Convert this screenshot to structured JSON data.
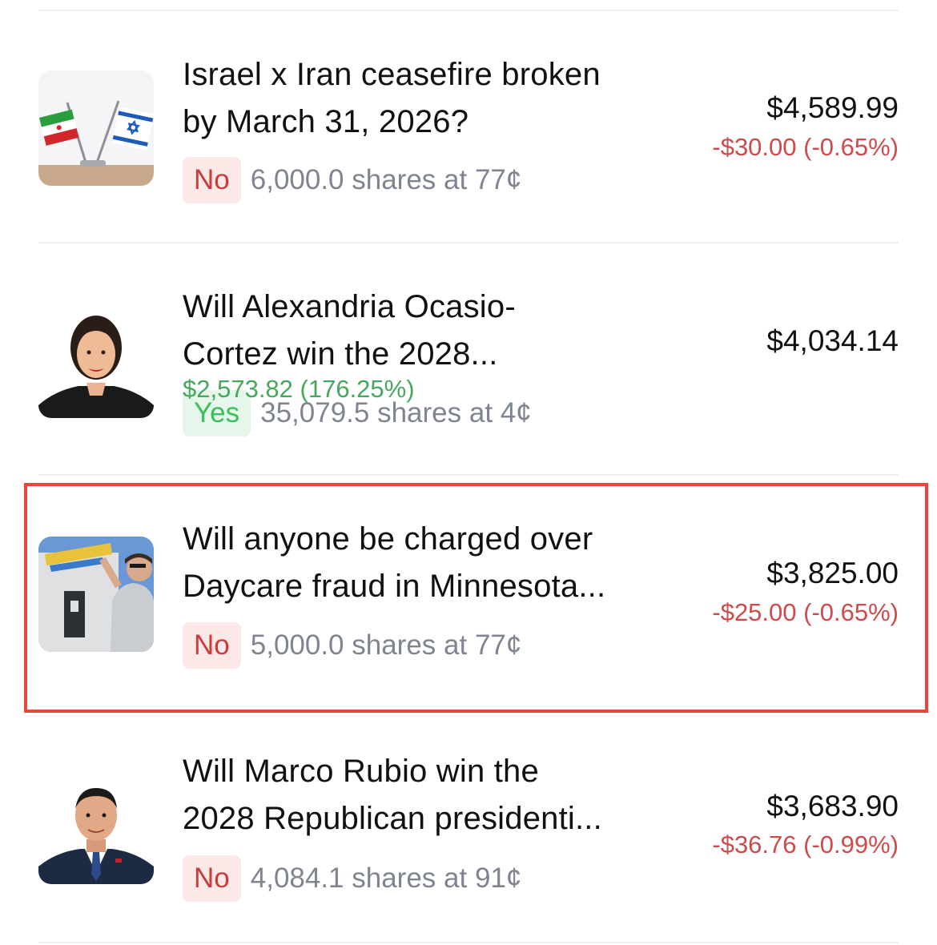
{
  "positions": [
    {
      "title_line1": "Israel x Iran ceasefire broken",
      "title_line2": "by March 31, 2026?",
      "outcome": "No",
      "shares_text": "6,000.0 shares at 77¢",
      "value": "$4,589.99",
      "change": "-$30.00 (-0.65%)",
      "change_direction": "negative",
      "image": "flags-icon"
    },
    {
      "title_line1": "Will Alexandria Ocasio-",
      "title_line2": "Cortez win the 2028...",
      "outcome": "Yes",
      "shares_text": "35,079.5 shares at 4¢",
      "value": "$4,034.14",
      "change": "$2,573.82 (176.25%)",
      "change_direction": "positive",
      "image": "person-portrait"
    },
    {
      "title_line1": "Will anyone be charged over",
      "title_line2": "Daycare fraud in Minnesota...",
      "outcome": "No",
      "shares_text": "5,000.0 shares at 77¢",
      "value": "$3,825.00",
      "change": "-$25.00 (-0.65%)",
      "change_direction": "negative",
      "image": "street-photo",
      "highlighted": true
    },
    {
      "title_line1": "Will Marco Rubio win the",
      "title_line2": "2028 Republican presidenti...",
      "outcome": "No",
      "shares_text": "4,084.1 shares at 91¢",
      "value": "$3,683.90",
      "change": "-$36.76 (-0.99%)",
      "change_direction": "negative",
      "image": "person-portrait"
    }
  ],
  "colors": {
    "negative": "#cf4b4b",
    "positive": "#46a85c",
    "highlight_border": "#e8473b"
  }
}
